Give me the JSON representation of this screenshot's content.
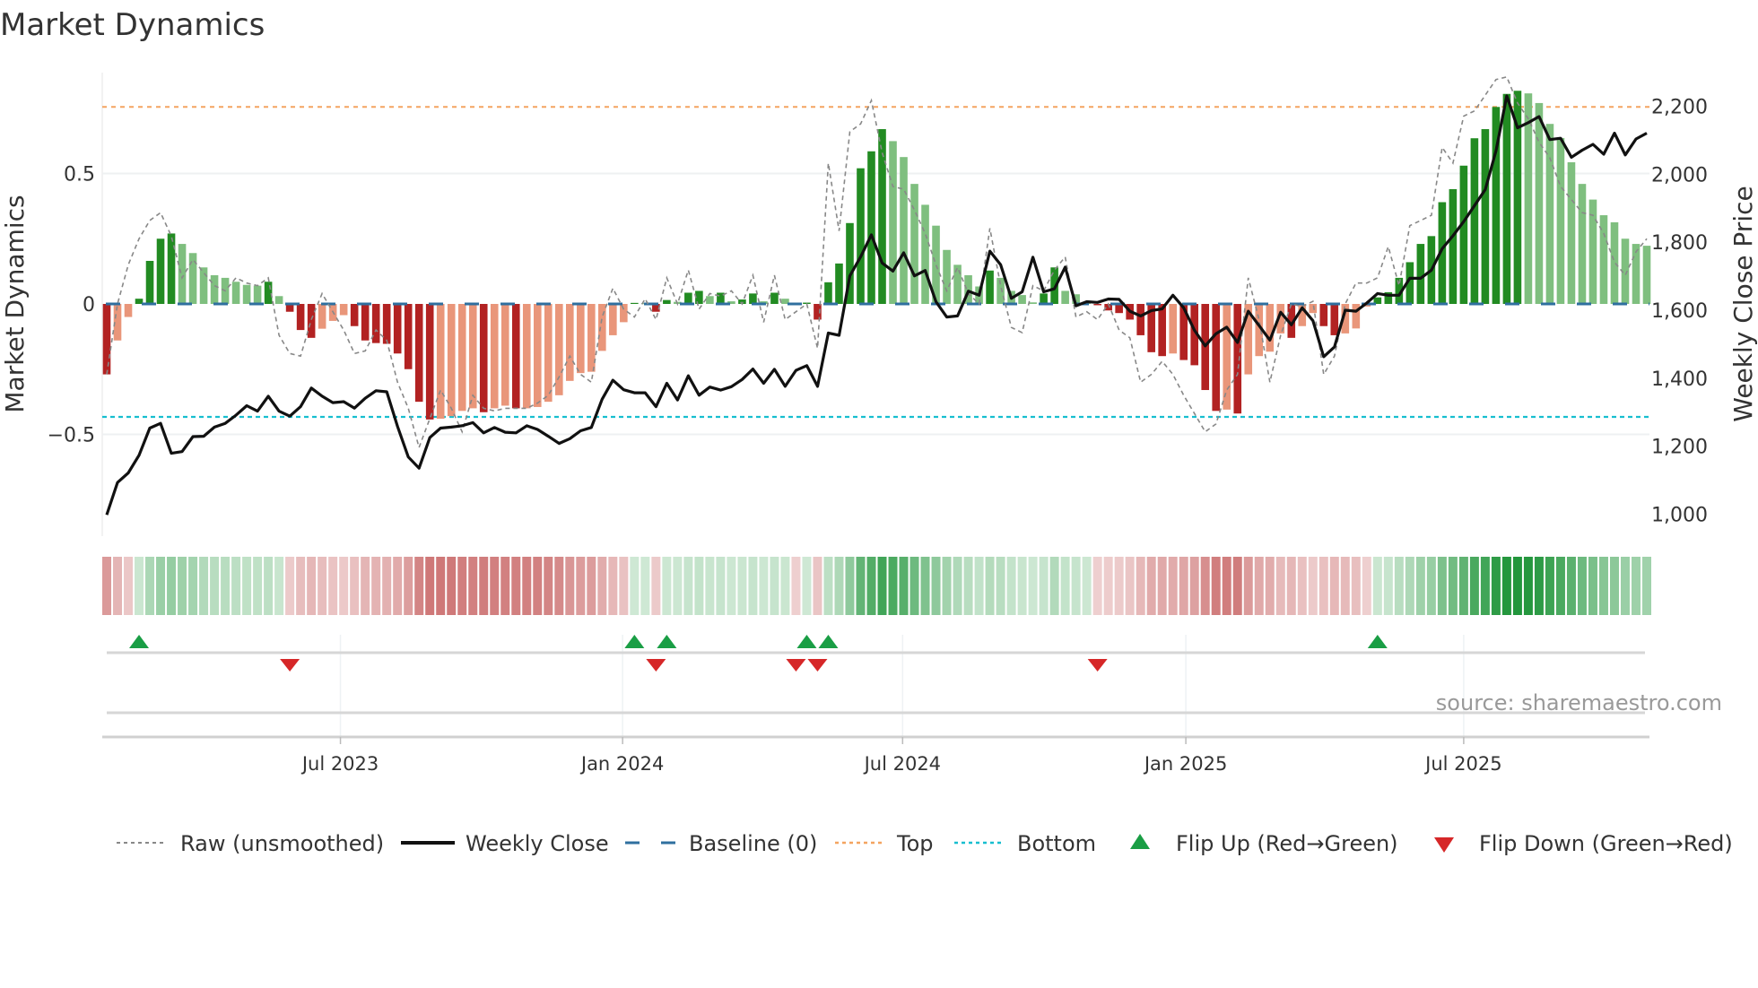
{
  "title": "Market Dynamics",
  "chart_data": {
    "type": "bar+line",
    "title": "Market Dynamics",
    "ylabel_left": "Market Dynamics",
    "ylabel_right": "Weekly Close Price",
    "ylim_left": [
      -0.78,
      0.95
    ],
    "ylim_right": [
      900,
      2300
    ],
    "left_ticks": [
      {
        "v": 0.5,
        "label": "0.5"
      },
      {
        "v": 0,
        "label": "0"
      },
      {
        "v": -0.5,
        "label": "−0.5"
      }
    ],
    "right_ticks": [
      {
        "v": 2200,
        "label": "2,200"
      },
      {
        "v": 2000,
        "label": "2,000"
      },
      {
        "v": 1800,
        "label": "1,800"
      },
      {
        "v": 1600,
        "label": "1,600"
      },
      {
        "v": 1400,
        "label": "1,400"
      },
      {
        "v": 1200,
        "label": "1,200"
      },
      {
        "v": 1000,
        "label": "1,000"
      }
    ],
    "x_ticks": [
      {
        "week": 21.7,
        "label": "Jul 2023"
      },
      {
        "week": 47.9,
        "label": "Jan 2024"
      },
      {
        "week": 73.9,
        "label": "Jul 2024"
      },
      {
        "week": 100.2,
        "label": "Jan 2025"
      },
      {
        "week": 126,
        "label": "Jul 2025"
      }
    ],
    "top_level": 0.755,
    "bottom_level": -0.433,
    "baseline": 0,
    "smoothed": [
      -0.27,
      -0.14,
      -0.05,
      0.02,
      0.165,
      0.25,
      0.27,
      0.23,
      0.195,
      0.14,
      0.11,
      0.1,
      0.085,
      0.073,
      0.07,
      0.085,
      0.03,
      -0.03,
      -0.1,
      -0.13,
      -0.095,
      -0.065,
      -0.043,
      -0.085,
      -0.14,
      -0.15,
      -0.153,
      -0.19,
      -0.25,
      -0.375,
      -0.443,
      -0.44,
      -0.43,
      -0.41,
      -0.4,
      -0.415,
      -0.4,
      -0.39,
      -0.4,
      -0.4,
      -0.395,
      -0.375,
      -0.35,
      -0.295,
      -0.265,
      -0.26,
      -0.18,
      -0.12,
      -0.07,
      0.004,
      0.003,
      -0.03,
      0.015,
      0.008,
      0.043,
      0.05,
      0.03,
      0.043,
      0.01,
      0.017,
      0.04,
      0.01,
      0.043,
      0.02,
      -0.005,
      0.005,
      -0.06,
      0.083,
      0.155,
      0.31,
      0.52,
      0.585,
      0.67,
      0.624,
      0.563,
      0.46,
      0.38,
      0.3,
      0.207,
      0.15,
      0.11,
      0.067,
      0.128,
      0.1,
      0.05,
      0.034,
      0.006,
      0.04,
      0.14,
      0.05,
      0.037,
      0.008,
      -0.005,
      -0.025,
      -0.035,
      -0.06,
      -0.12,
      -0.185,
      -0.2,
      -0.19,
      -0.215,
      -0.235,
      -0.33,
      -0.41,
      -0.405,
      -0.42,
      -0.27,
      -0.2,
      -0.183,
      -0.113,
      -0.13,
      -0.085,
      -0.035,
      -0.085,
      -0.12,
      -0.113,
      -0.094,
      -0.01,
      0.025,
      0.045,
      0.1,
      0.16,
      0.23,
      0.26,
      0.39,
      0.44,
      0.53,
      0.635,
      0.67,
      0.755,
      0.805,
      0.817,
      0.807,
      0.77,
      0.69,
      0.636,
      0.543,
      0.46,
      0.4,
      0.34,
      0.313,
      0.25,
      0.23,
      0.223
    ],
    "raw": [
      -0.27,
      0.0,
      0.15,
      0.25,
      0.32,
      0.35,
      0.26,
      0.1,
      0.17,
      0.12,
      0.07,
      0.05,
      0.1,
      0.08,
      0.07,
      0.1,
      -0.12,
      -0.19,
      -0.2,
      -0.06,
      0.04,
      -0.03,
      -0.1,
      -0.19,
      -0.18,
      -0.1,
      -0.14,
      -0.3,
      -0.4,
      -0.55,
      -0.44,
      -0.33,
      -0.4,
      -0.49,
      -0.35,
      -0.4,
      -0.41,
      -0.4,
      -0.4,
      -0.4,
      -0.38,
      -0.35,
      -0.28,
      -0.2,
      -0.27,
      -0.3,
      -0.05,
      0.06,
      -0.02,
      -0.05,
      0.02,
      -0.06,
      0.1,
      0.0,
      0.13,
      -0.02,
      0.04,
      0.03,
      0.05,
      0.0,
      0.11,
      -0.07,
      0.11,
      -0.06,
      -0.03,
      0.0,
      -0.17,
      0.54,
      0.28,
      0.66,
      0.69,
      0.78,
      0.58,
      0.45,
      0.44,
      0.36,
      0.27,
      0.15,
      0.05,
      0.14,
      0.04,
      0.0,
      0.29,
      0.07,
      -0.09,
      -0.11,
      0.07,
      0.05,
      0.13,
      0.18,
      -0.05,
      -0.03,
      -0.06,
      0.0,
      -0.1,
      -0.13,
      -0.3,
      -0.27,
      -0.22,
      -0.27,
      -0.35,
      -0.42,
      -0.49,
      -0.46,
      -0.33,
      -0.27,
      0.1,
      -0.06,
      -0.3,
      -0.12,
      0.0,
      -0.01,
      0.01,
      -0.27,
      -0.2,
      0.0,
      0.08,
      0.08,
      0.1,
      0.22,
      0.07,
      0.3,
      0.32,
      0.34,
      0.6,
      0.54,
      0.72,
      0.74,
      0.8,
      0.86,
      0.87,
      0.77,
      0.71,
      0.62,
      0.56,
      0.45,
      0.4,
      0.35,
      0.34,
      0.27,
      0.16,
      0.11,
      0.2,
      0.25
    ],
    "weekly_close": [
      998,
      1093,
      1121,
      1173,
      1253,
      1267,
      1179,
      1184,
      1228,
      1229,
      1256,
      1267,
      1291,
      1319,
      1303,
      1347,
      1303,
      1288,
      1316,
      1371,
      1347,
      1328,
      1331,
      1312,
      1341,
      1363,
      1360,
      1258,
      1168,
      1135,
      1225,
      1253,
      1256,
      1260,
      1269,
      1239,
      1255,
      1241,
      1239,
      1260,
      1249,
      1229,
      1208,
      1222,
      1245,
      1255,
      1338,
      1394,
      1366,
      1357,
      1357,
      1316,
      1385,
      1336,
      1407,
      1350,
      1374,
      1365,
      1375,
      1396,
      1427,
      1385,
      1426,
      1376,
      1423,
      1437,
      1376,
      1533,
      1526,
      1701,
      1757,
      1822,
      1739,
      1715,
      1769,
      1701,
      1717,
      1625,
      1580,
      1583,
      1656,
      1644,
      1774,
      1734,
      1635,
      1654,
      1756,
      1654,
      1663,
      1727,
      1613,
      1625,
      1623,
      1633,
      1632,
      1597,
      1583,
      1599,
      1604,
      1644,
      1607,
      1541,
      1495,
      1531,
      1550,
      1505,
      1597,
      1555,
      1512,
      1594,
      1557,
      1607,
      1569,
      1463,
      1492,
      1600,
      1597,
      1621,
      1649,
      1644,
      1644,
      1694,
      1694,
      1718,
      1781,
      1819,
      1861,
      1908,
      1955,
      2069,
      2231,
      2137,
      2152,
      2170,
      2102,
      2106,
      2050,
      2071,
      2088,
      2059,
      2121,
      2057,
      2104,
      2121
    ],
    "flip_up_weeks": [
      3,
      49,
      52,
      65,
      67,
      118
    ],
    "flip_down_weeks": [
      17,
      51,
      64,
      66,
      92
    ],
    "legend": {
      "placement": "bottom",
      "raw": "Raw (unsmoothed)",
      "close": "Weekly Close",
      "baseline": "Baseline (0)",
      "top": "Top",
      "bottom": "Bottom",
      "flip_up": "Flip Up (Red→Green)",
      "flip_down": "Flip Down (Green→Red)"
    },
    "colors": {
      "up_strong": "#228b22",
      "up_weak": "#7fbf7f",
      "down_strong": "#b22222",
      "down_weak": "#e9967a",
      "baseline": "#2f6f9f",
      "top": "#f4a460",
      "bottom": "#17becf",
      "flip_up": "#1a9e45",
      "flip_down": "#d62728",
      "close": "#111111",
      "raw": "#888888"
    }
  },
  "source": "source: sharemaestro.com"
}
